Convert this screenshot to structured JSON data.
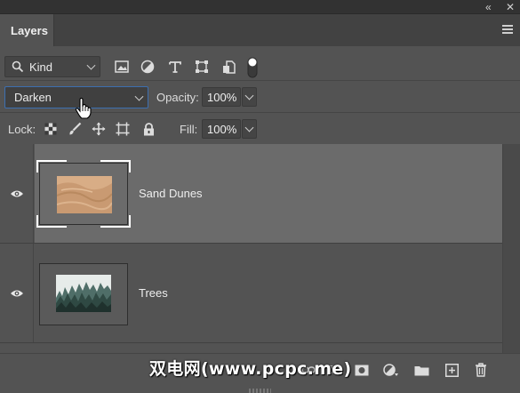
{
  "window": {
    "collapse_glyph": "«",
    "close_glyph": "✕"
  },
  "panel": {
    "tab_label": "Layers"
  },
  "filter_row": {
    "kind_label": "Kind",
    "filter_icons": [
      "image-filter-icon",
      "adjustment-filter-icon",
      "type-filter-icon",
      "shape-filter-icon",
      "smart-object-filter-icon",
      "filter-toggle-icon"
    ]
  },
  "blend_row": {
    "blend_mode": "Darken",
    "opacity_label": "Opacity:",
    "opacity_value": "100%"
  },
  "lock_row": {
    "lock_label": "Lock:",
    "lock_icons": [
      "lock-transparent-pixels-icon",
      "lock-image-pixels-icon",
      "lock-position-icon",
      "lock-artboard-icon",
      "lock-all-icon"
    ],
    "fill_label": "Fill:",
    "fill_value": "100%"
  },
  "layers": [
    {
      "name": "Sand Dunes",
      "visible": true,
      "selected": true,
      "thumbnail": "sand-dunes-thumbnail"
    },
    {
      "name": "Trees",
      "visible": true,
      "selected": false,
      "thumbnail": "trees-thumbnail"
    }
  ],
  "bottom_bar": {
    "watermark": "双电网(www.pcpc.me)",
    "icons": [
      "link-layers-icon",
      "fx-icon",
      "add-mask-icon",
      "adjustment-layer-icon",
      "new-group-icon",
      "new-layer-icon",
      "delete-icon"
    ]
  },
  "colors": {
    "panel_bg": "#535353",
    "selected_layer": "#6b6b6b",
    "focus_border": "#3c6fb0"
  }
}
